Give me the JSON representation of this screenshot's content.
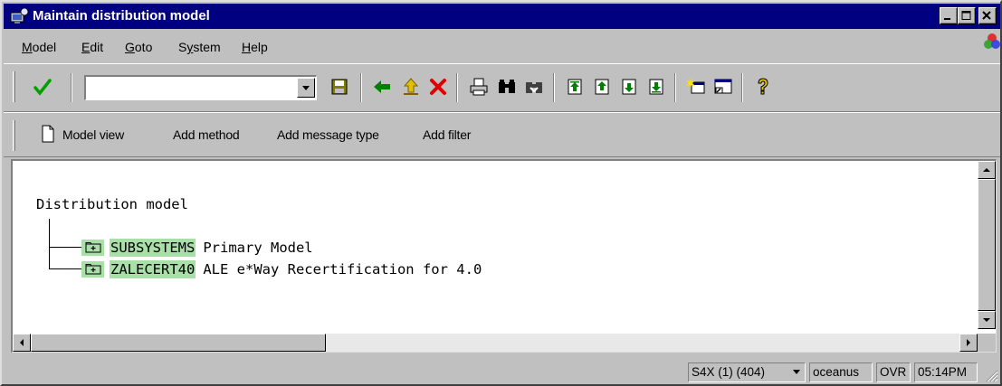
{
  "window": {
    "title": "Maintain distribution model",
    "title_bar_color": "#000080"
  },
  "menu": {
    "items": [
      {
        "label": "Model",
        "mnemonic": "M",
        "rest": "odel"
      },
      {
        "label": "Edit",
        "mnemonic": "E",
        "rest": "dit"
      },
      {
        "label": "Goto",
        "mnemonic": "G",
        "rest": "oto"
      },
      {
        "label": "System",
        "mnemonic": "y",
        "pre": "S",
        "rest": "stem"
      },
      {
        "label": "Help",
        "mnemonic": "H",
        "rest": "elp"
      }
    ]
  },
  "standard_toolbar": {
    "command_field": {
      "value": "",
      "placeholder": ""
    },
    "icons": [
      "enter-check-icon",
      "save-icon",
      "back-icon",
      "exit-icon",
      "cancel-icon",
      "print-icon",
      "find-icon",
      "find-next-icon",
      "first-page-icon",
      "previous-page-icon",
      "next-page-icon",
      "last-page-icon",
      "create-session-icon",
      "shortcut-icon",
      "help-icon"
    ]
  },
  "application_toolbar": {
    "model_view": "Model view",
    "add_method": "Add method",
    "add_message_type": "Add message type",
    "add_filter": "Add filter"
  },
  "tree": {
    "root": "Distribution model",
    "nodes": [
      {
        "key": "SUBSYSTEMS",
        "description": "Primary Model"
      },
      {
        "key": "ZALECERT40",
        "description": "ALE e*Way Recertification for 4.0"
      }
    ],
    "highlight_color": "#a8e0a8"
  },
  "statusbar": {
    "system": "S4X (1) (404)",
    "server": "oceanus",
    "mode": "OVR",
    "time": "05:14PM"
  }
}
